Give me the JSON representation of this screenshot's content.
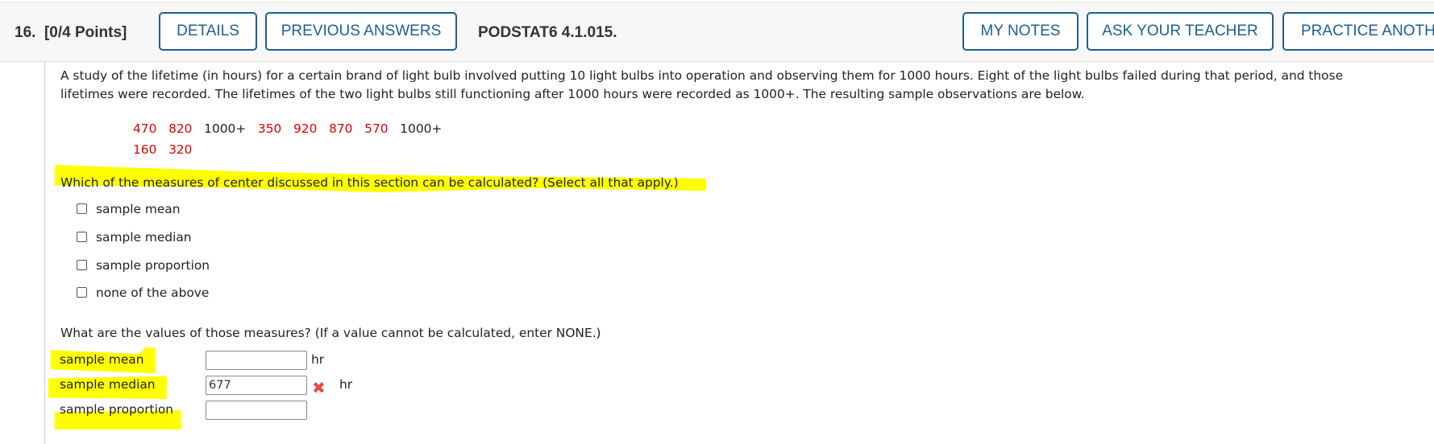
{
  "header": {
    "question_number": "16.",
    "points": "[0/4 Points]",
    "details_label": "DETAILS",
    "previous_answers_label": "PREVIOUS ANSWERS",
    "problem_code": "PODSTAT6 4.1.015.",
    "my_notes_label": "MY NOTES",
    "ask_teacher_label": "ASK YOUR TEACHER",
    "practice_label": "PRACTICE ANOTH"
  },
  "problem": {
    "line1": "A study of the lifetime (in hours) for a certain brand of light bulb involved putting 10 light bulbs into operation and observing them for 1000 hours. Eight of the light bulbs failed during that period, and those",
    "line2": "lifetimes were recorded. The lifetimes of the two light bulbs still functioning after 1000 hours were recorded as 1000+. The resulting sample observations are below.",
    "observations_row1": [
      "470",
      "820",
      "1000+",
      "350",
      "920",
      "870",
      "570",
      "1000+"
    ],
    "observations_row2": [
      "160",
      "320"
    ]
  },
  "question1": {
    "prompt": "Which of the measures of center discussed in this section can be calculated? (Select all that apply.)",
    "options": [
      {
        "label": "sample mean",
        "checked": false
      },
      {
        "label": "sample median",
        "checked": false
      },
      {
        "label": "sample proportion",
        "checked": false
      },
      {
        "label": "none of the above",
        "checked": false
      }
    ]
  },
  "question2": {
    "prompt": "What are the values of those measures? (If a value cannot be calculated, enter NONE.)",
    "rows": [
      {
        "label": "sample mean",
        "value": "",
        "unit": "hr"
      },
      {
        "label": "sample median",
        "value": "677",
        "unit": "hr",
        "status": "incorrect"
      },
      {
        "label": "sample proportion",
        "value": "",
        "unit": ""
      }
    ]
  },
  "colors": {
    "accent": "#1d5f90",
    "highlight": "#ffff00",
    "data_red": "#dd0000",
    "incorrect": "#e84a4a"
  }
}
